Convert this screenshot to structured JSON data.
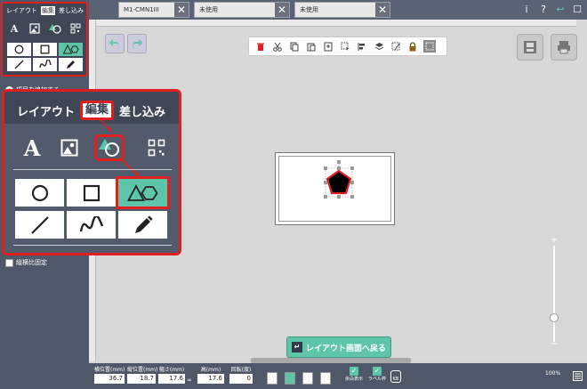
{
  "tabs": [
    {
      "label": "M1-CMN1III",
      "close": "✕"
    },
    {
      "label": "未使用",
      "close": "✕"
    },
    {
      "label": "未使用",
      "close": "✕"
    }
  ],
  "top_buttons": {
    "info": "i",
    "help": "?",
    "back": "↩",
    "exit": "☐"
  },
  "sidebar": {
    "tabs": [
      "レイアウト",
      "編集",
      "差し込み"
    ],
    "text_tool_glyph": "A",
    "add_row_label": "項目を追加する",
    "fixed_ratio_label": "縦横比固定"
  },
  "callout": {
    "tabs": [
      "レイアウト",
      "編集",
      "差し込み"
    ],
    "text_tool_glyph": "A"
  },
  "bottom": {
    "fields": [
      {
        "label": "横位置(mm)",
        "value": "36.7"
      },
      {
        "label": "縦位置(mm)",
        "value": "18.7"
      },
      {
        "label": "幅さ(mm)",
        "value": "17.6"
      },
      {
        "label": "高(mm)",
        "value": "17.6"
      },
      {
        "label": "回転(度)",
        "value": "0"
      }
    ],
    "checks": [
      {
        "label": "余白表示",
        "mark": "✓"
      },
      {
        "label": "ラベル枠",
        "mark": "✓"
      }
    ],
    "kb_label": "KB",
    "zoom": "100%"
  },
  "back_button_label": "レイアウト画面へ戻る",
  "zoom_labels": {
    "plus": "+",
    "minus": "−"
  },
  "colors": {
    "accent": "#5fc5a8",
    "highlight": "#e02020",
    "sidebar": "#4f5868"
  }
}
